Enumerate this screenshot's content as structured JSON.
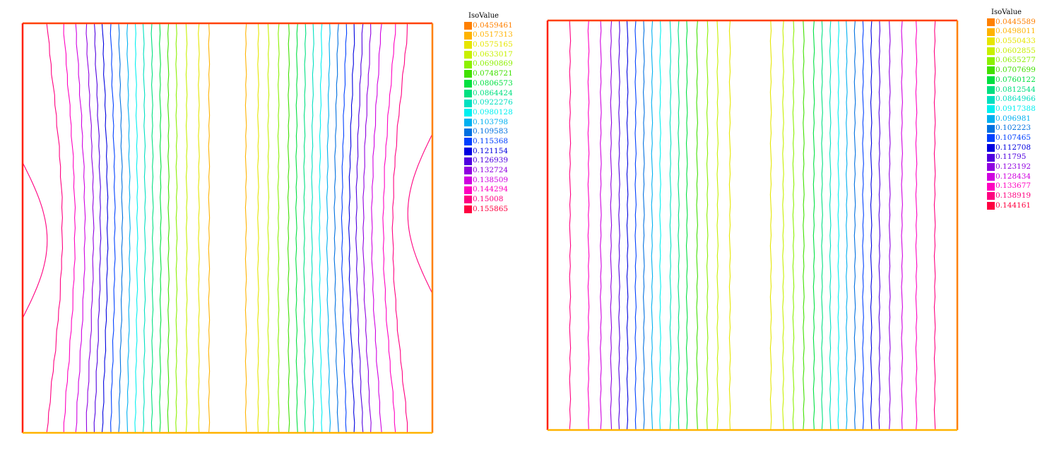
{
  "chart_data": [
    {
      "type": "contour",
      "title": "",
      "legend": {
        "title": "IsoValue",
        "placement": "right",
        "entries": [
          {
            "value": "0.0459461",
            "color": "#ff8000"
          },
          {
            "value": "0.0517313",
            "color": "#ffb300"
          },
          {
            "value": "0.0575165",
            "color": "#e6e600"
          },
          {
            "value": "0.0633017",
            "color": "#c8f000"
          },
          {
            "value": "0.0690869",
            "color": "#8cf000"
          },
          {
            "value": "0.0748721",
            "color": "#40e000"
          },
          {
            "value": "0.0806573",
            "color": "#00e040"
          },
          {
            "value": "0.0864424",
            "color": "#00e080"
          },
          {
            "value": "0.0922276",
            "color": "#00e0c0"
          },
          {
            "value": "0.0980128",
            "color": "#00f0f0"
          },
          {
            "value": "0.103798",
            "color": "#00b0f0"
          },
          {
            "value": "0.109583",
            "color": "#0070e0"
          },
          {
            "value": "0.115368",
            "color": "#0040ff"
          },
          {
            "value": "0.121154",
            "color": "#0000e0"
          },
          {
            "value": "0.126939",
            "color": "#5000e0"
          },
          {
            "value": "0.132724",
            "color": "#9000e0"
          },
          {
            "value": "0.138509",
            "color": "#d000e0"
          },
          {
            "value": "0.144294",
            "color": "#ff00c0"
          },
          {
            "value": "0.15008",
            "color": "#ff0080"
          },
          {
            "value": "0.155865",
            "color": "#ff0040"
          }
        ]
      },
      "contour_lines": [
        {
          "x": 0.06,
          "color": "#ff0080"
        },
        {
          "x": 0.1,
          "color": "#ff00c0"
        },
        {
          "x": 0.13,
          "color": "#d000e0"
        },
        {
          "x": 0.155,
          "color": "#9000e0"
        },
        {
          "x": 0.175,
          "color": "#5000e0"
        },
        {
          "x": 0.195,
          "color": "#0000e0"
        },
        {
          "x": 0.215,
          "color": "#0040ff"
        },
        {
          "x": 0.235,
          "color": "#0070e0"
        },
        {
          "x": 0.255,
          "color": "#00b0f0"
        },
        {
          "x": 0.275,
          "color": "#00f0f0"
        },
        {
          "x": 0.295,
          "color": "#00e0c0"
        },
        {
          "x": 0.315,
          "color": "#00e080"
        },
        {
          "x": 0.335,
          "color": "#00e040"
        },
        {
          "x": 0.355,
          "color": "#40e000"
        },
        {
          "x": 0.375,
          "color": "#8cf000"
        },
        {
          "x": 0.4,
          "color": "#c8f000"
        },
        {
          "x": 0.43,
          "color": "#e6e600"
        },
        {
          "x": 0.455,
          "color": "#ffb300"
        },
        {
          "x": 0.545,
          "color": "#ffb300"
        },
        {
          "x": 0.575,
          "color": "#e6e600"
        },
        {
          "x": 0.6,
          "color": "#c8f000"
        },
        {
          "x": 0.625,
          "color": "#8cf000"
        },
        {
          "x": 0.65,
          "color": "#40e000"
        },
        {
          "x": 0.67,
          "color": "#00e040"
        },
        {
          "x": 0.69,
          "color": "#00e080"
        },
        {
          "x": 0.71,
          "color": "#00e0c0"
        },
        {
          "x": 0.73,
          "color": "#00f0f0"
        },
        {
          "x": 0.75,
          "color": "#00b0f0"
        },
        {
          "x": 0.77,
          "color": "#0070e0"
        },
        {
          "x": 0.79,
          "color": "#0040ff"
        },
        {
          "x": 0.81,
          "color": "#0000e0"
        },
        {
          "x": 0.83,
          "color": "#5000e0"
        },
        {
          "x": 0.85,
          "color": "#9000e0"
        },
        {
          "x": 0.875,
          "color": "#d000e0"
        },
        {
          "x": 0.91,
          "color": "#ff00c0"
        },
        {
          "x": 0.94,
          "color": "#ff0080"
        }
      ],
      "curved_edges": true,
      "border_colors": {
        "top": "#ff4000",
        "left": "#ff2000",
        "right": "#ff8000",
        "bottom": "#ffb300"
      }
    },
    {
      "type": "contour",
      "title": "",
      "legend": {
        "title": "IsoValue",
        "placement": "right",
        "entries": [
          {
            "value": "0.0445589",
            "color": "#ff8000"
          },
          {
            "value": "0.0498011",
            "color": "#ffb300"
          },
          {
            "value": "0.0550433",
            "color": "#e6e600"
          },
          {
            "value": "0.0602855",
            "color": "#c8f000"
          },
          {
            "value": "0.0655277",
            "color": "#8cf000"
          },
          {
            "value": "0.0707699",
            "color": "#40e000"
          },
          {
            "value": "0.0760122",
            "color": "#00e040"
          },
          {
            "value": "0.0812544",
            "color": "#00e080"
          },
          {
            "value": "0.0864966",
            "color": "#00e0c0"
          },
          {
            "value": "0.0917388",
            "color": "#00f0f0"
          },
          {
            "value": "0.096981",
            "color": "#00b0f0"
          },
          {
            "value": "0.102223",
            "color": "#0070e0"
          },
          {
            "value": "0.107465",
            "color": "#0040ff"
          },
          {
            "value": "0.112708",
            "color": "#0000e0"
          },
          {
            "value": "0.11795",
            "color": "#5000e0"
          },
          {
            "value": "0.123192",
            "color": "#9000e0"
          },
          {
            "value": "0.128434",
            "color": "#d000e0"
          },
          {
            "value": "0.133677",
            "color": "#ff00c0"
          },
          {
            "value": "0.138919",
            "color": "#ff0080"
          },
          {
            "value": "0.144161",
            "color": "#ff0040"
          }
        ]
      },
      "contour_lines": [
        {
          "x": 0.055,
          "color": "#ff0080"
        },
        {
          "x": 0.1,
          "color": "#ff00c0"
        },
        {
          "x": 0.13,
          "color": "#d000e0"
        },
        {
          "x": 0.155,
          "color": "#9000e0"
        },
        {
          "x": 0.175,
          "color": "#5000e0"
        },
        {
          "x": 0.195,
          "color": "#0000e0"
        },
        {
          "x": 0.215,
          "color": "#0040ff"
        },
        {
          "x": 0.235,
          "color": "#0070e0"
        },
        {
          "x": 0.255,
          "color": "#00b0f0"
        },
        {
          "x": 0.275,
          "color": "#00f0f0"
        },
        {
          "x": 0.3,
          "color": "#00e0c0"
        },
        {
          "x": 0.32,
          "color": "#00e080"
        },
        {
          "x": 0.34,
          "color": "#00e040"
        },
        {
          "x": 0.365,
          "color": "#40e000"
        },
        {
          "x": 0.39,
          "color": "#8cf000"
        },
        {
          "x": 0.415,
          "color": "#c8f000"
        },
        {
          "x": 0.445,
          "color": "#e6e600"
        },
        {
          "x": 0.545,
          "color": "#e6e600"
        },
        {
          "x": 0.575,
          "color": "#c8f000"
        },
        {
          "x": 0.6,
          "color": "#8cf000"
        },
        {
          "x": 0.625,
          "color": "#40e000"
        },
        {
          "x": 0.65,
          "color": "#00e040"
        },
        {
          "x": 0.67,
          "color": "#00e080"
        },
        {
          "x": 0.69,
          "color": "#00e0c0"
        },
        {
          "x": 0.71,
          "color": "#00f0f0"
        },
        {
          "x": 0.73,
          "color": "#00b0f0"
        },
        {
          "x": 0.75,
          "color": "#0070e0"
        },
        {
          "x": 0.77,
          "color": "#0040ff"
        },
        {
          "x": 0.79,
          "color": "#0000e0"
        },
        {
          "x": 0.81,
          "color": "#5000e0"
        },
        {
          "x": 0.835,
          "color": "#9000e0"
        },
        {
          "x": 0.865,
          "color": "#d000e0"
        },
        {
          "x": 0.9,
          "color": "#ff00c0"
        },
        {
          "x": 0.945,
          "color": "#ff0080"
        }
      ],
      "curved_edges": false,
      "border_colors": {
        "top": "#ff4000",
        "left": "#ff2000",
        "right": "#ff8000",
        "bottom": "#ffb300"
      }
    }
  ]
}
